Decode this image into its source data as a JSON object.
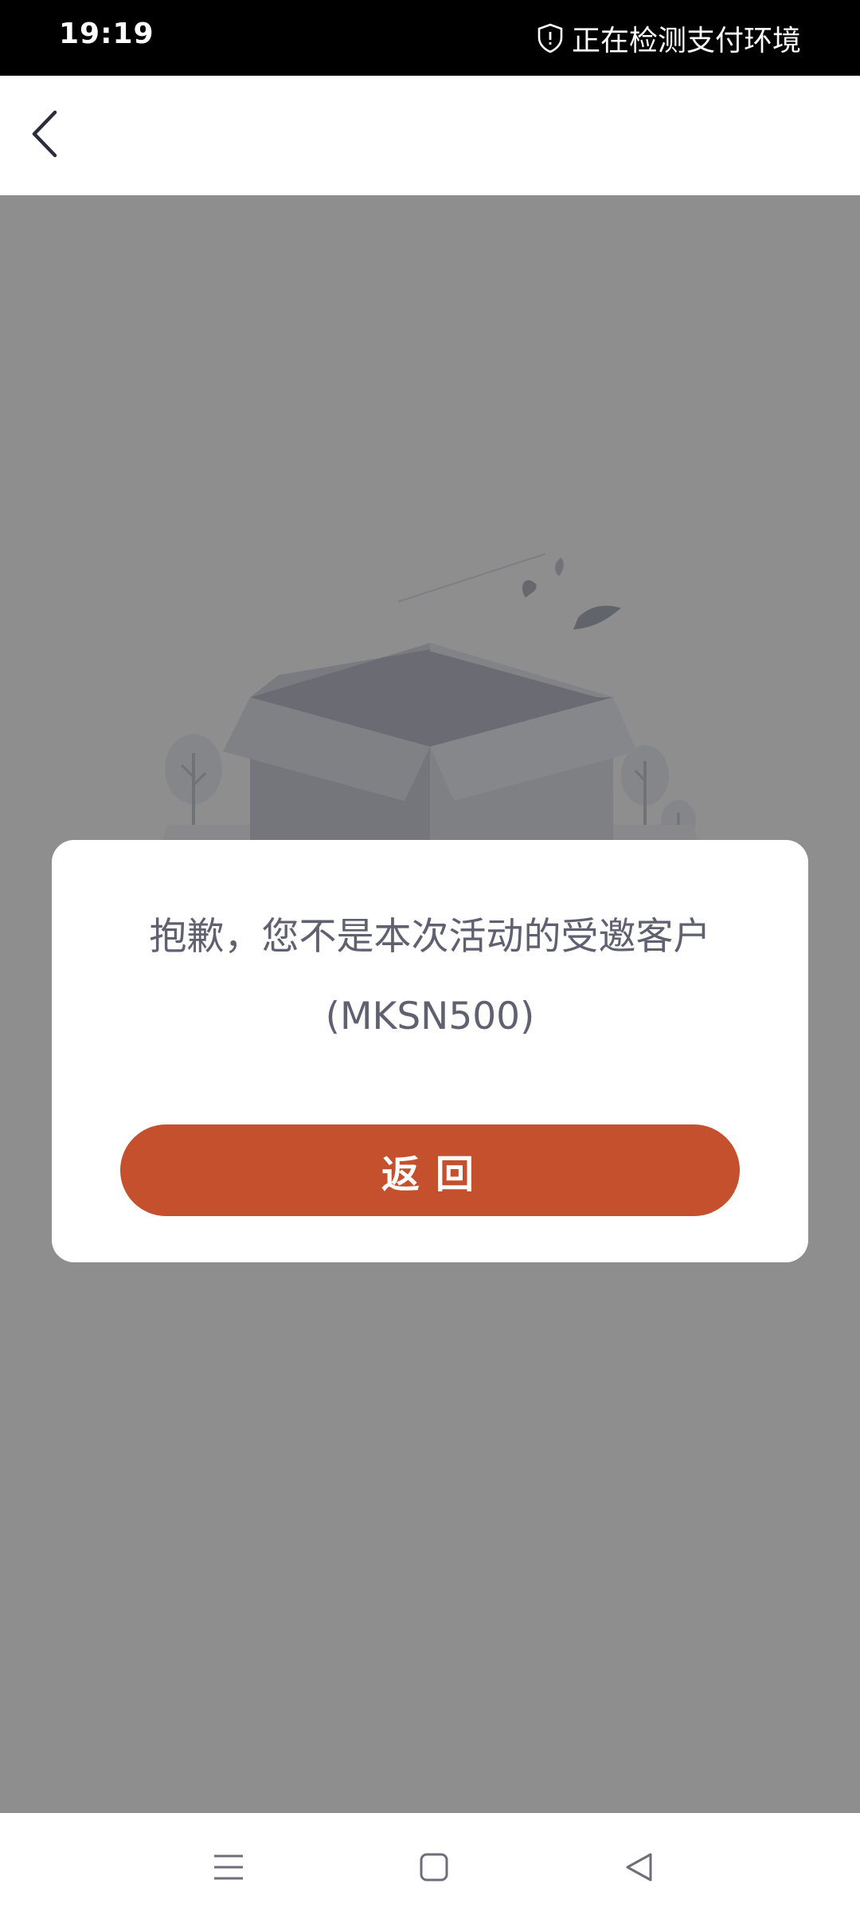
{
  "status_bar": {
    "time": "19:19",
    "security_text": "正在检测支付环境",
    "security_icon": "shield-icon"
  },
  "nav": {
    "back_icon": "chevron-left-icon"
  },
  "illustration": {
    "icon": "empty-box-illustration"
  },
  "dialog": {
    "message_line1": "抱歉，您不是本次活动的受邀客户",
    "message_line2": "(MKSN500)",
    "button_label": "返回",
    "button_color": "#c4502e"
  },
  "system_nav": {
    "menu_icon": "menu-icon",
    "home_icon": "home-square-icon",
    "back_icon": "back-triangle-icon"
  }
}
